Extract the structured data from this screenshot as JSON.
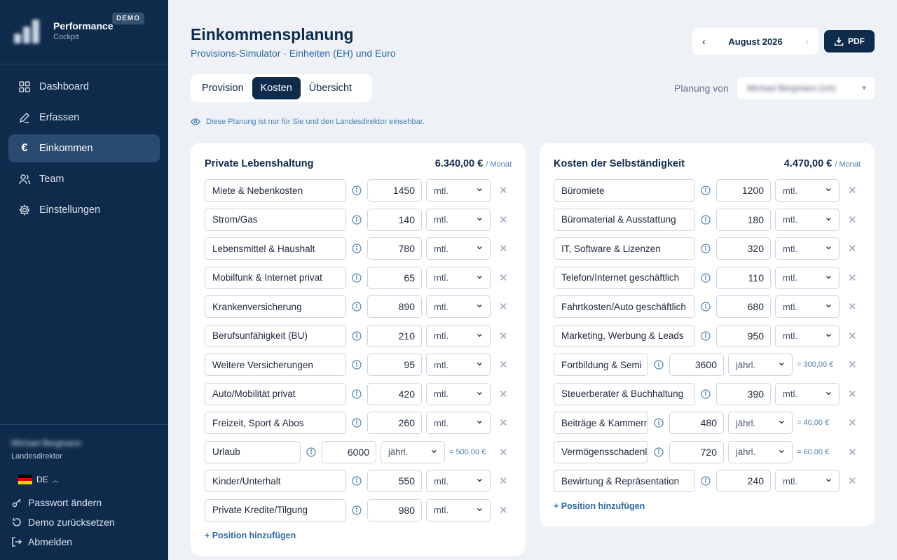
{
  "brand": {
    "title": "Performance",
    "subtitle": "Cockpit",
    "badge": "DEMO"
  },
  "nav": [
    {
      "label": "Dashboard",
      "icon": "grid-icon"
    },
    {
      "label": "Erfassen",
      "icon": "pencil-icon"
    },
    {
      "label": "Einkommen",
      "icon": "euro-icon",
      "active": true
    },
    {
      "label": "Team",
      "icon": "users-icon"
    },
    {
      "label": "Einstellungen",
      "icon": "gear-icon"
    }
  ],
  "user": {
    "name": "Michael Bergmann",
    "role": "Landesdirektor"
  },
  "language": {
    "code": "DE"
  },
  "footer_links": {
    "password": "Passwort ändern",
    "reset": "Demo zurücksetzen",
    "logout": "Abmelden"
  },
  "header": {
    "title": "Einkommensplanung",
    "subtitle": "Provisions-Simulator · Einheiten (EH) und Euro",
    "month": "August 2026",
    "pdf_label": "PDF"
  },
  "tabs": [
    {
      "label": "Provision"
    },
    {
      "label": "Kosten",
      "active": true
    },
    {
      "label": "Übersicht"
    }
  ],
  "planung": {
    "label": "Planung von",
    "selected": "Michael Bergmann (ich)"
  },
  "notice": "Diese Planung ist nur für Sie und den Landesdirektor einsehbar.",
  "private": {
    "title": "Private Lebenshaltung",
    "total": "6.340,00 €",
    "per": "/ Monat",
    "add_label": "+ Position hinzufügen",
    "rows": [
      {
        "name": "Miete & Nebenkosten",
        "amount": "1450",
        "period": "mtl.",
        "conv": ""
      },
      {
        "name": "Strom/Gas",
        "amount": "140",
        "period": "mtl.",
        "conv": ""
      },
      {
        "name": "Lebensmittel & Haushalt",
        "amount": "780",
        "period": "mtl.",
        "conv": ""
      },
      {
        "name": "Mobilfunk & Internet privat",
        "amount": "65",
        "period": "mtl.",
        "conv": ""
      },
      {
        "name": "Krankenversicherung",
        "amount": "890",
        "period": "mtl.",
        "conv": ""
      },
      {
        "name": "Berufsunfähigkeit (BU)",
        "amount": "210",
        "period": "mtl.",
        "conv": ""
      },
      {
        "name": "Weitere Versicherungen",
        "amount": "95",
        "period": "mtl.",
        "conv": ""
      },
      {
        "name": "Auto/Mobilität privat",
        "amount": "420",
        "period": "mtl.",
        "conv": ""
      },
      {
        "name": "Freizeit, Sport & Abos",
        "amount": "260",
        "period": "mtl.",
        "conv": ""
      },
      {
        "name": "Urlaub",
        "amount": "6000",
        "period": "jährl.",
        "conv": "= 500,00 €"
      },
      {
        "name": "Kinder/Unterhalt",
        "amount": "550",
        "period": "mtl.",
        "conv": ""
      },
      {
        "name": "Private Kredite/Tilgung",
        "amount": "980",
        "period": "mtl.",
        "conv": ""
      }
    ]
  },
  "business": {
    "title": "Kosten der Selbständigkeit",
    "total": "4.470,00 €",
    "per": "/ Monat",
    "add_label": "+ Position hinzufügen",
    "rows": [
      {
        "name": "Büromiete",
        "amount": "1200",
        "period": "mtl.",
        "conv": ""
      },
      {
        "name": "Büromaterial & Ausstattung",
        "amount": "180",
        "period": "mtl.",
        "conv": ""
      },
      {
        "name": "IT, Software & Lizenzen",
        "amount": "320",
        "period": "mtl.",
        "conv": ""
      },
      {
        "name": "Telefon/Internet geschäftlich",
        "amount": "110",
        "period": "mtl.",
        "conv": ""
      },
      {
        "name": "Fahrtkosten/Auto geschäftlich",
        "amount": "680",
        "period": "mtl.",
        "conv": ""
      },
      {
        "name": "Marketing, Werbung & Leads",
        "amount": "950",
        "period": "mtl.",
        "conv": ""
      },
      {
        "name": "Fortbildung & Semi",
        "amount": "3600",
        "period": "jährl.",
        "conv": "= 300,00 €"
      },
      {
        "name": "Steuerberater & Buchhaltung",
        "amount": "390",
        "period": "mtl.",
        "conv": ""
      },
      {
        "name": "Beiträge & Kammerr",
        "amount": "480",
        "period": "jährl.",
        "conv": "= 40,00 €"
      },
      {
        "name": "Vermögensschadenl",
        "amount": "720",
        "period": "jährl.",
        "conv": "= 60,00 €"
      },
      {
        "name": "Bewirtung & Repräsentation",
        "amount": "240",
        "period": "mtl.",
        "conv": ""
      }
    ]
  }
}
